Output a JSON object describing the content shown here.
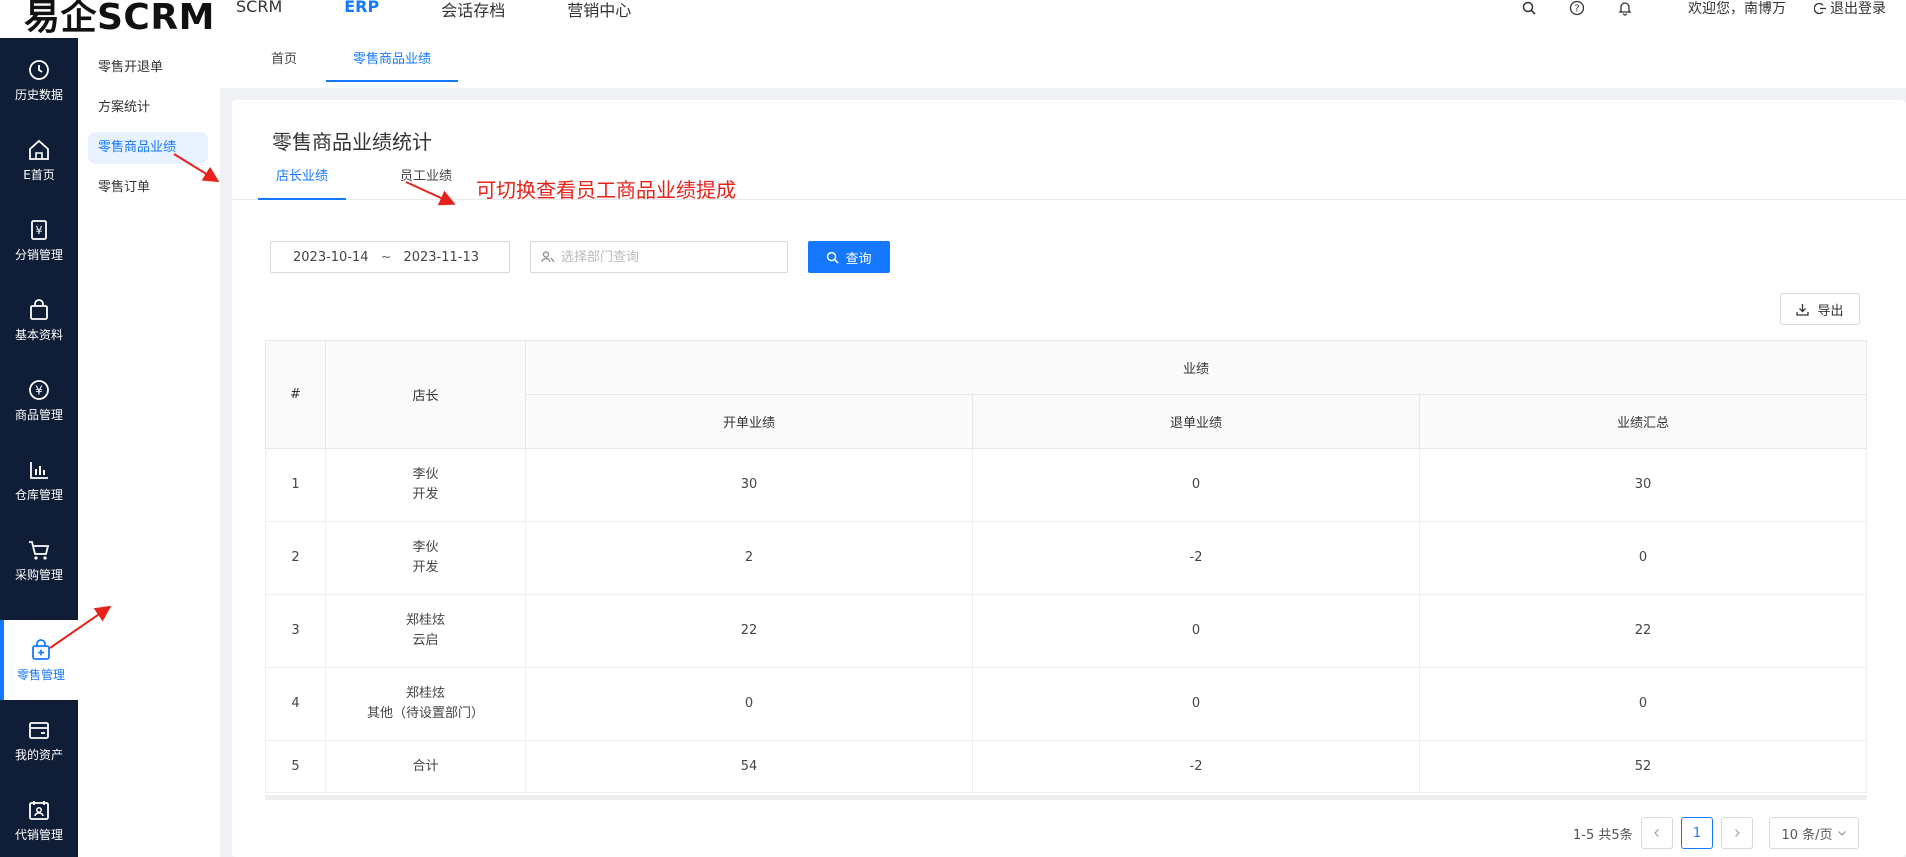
{
  "header": {
    "logo": "易企SCRM",
    "nav": [
      {
        "label": "SCRM",
        "active": false
      },
      {
        "label": "ERP",
        "active": true
      },
      {
        "label": "会话存档",
        "active": false
      },
      {
        "label": "营销中心",
        "active": false
      }
    ],
    "welcome": "欢迎您，南博万",
    "logout": "退出登录",
    "icons": [
      "search-icon",
      "help-icon",
      "bell-icon"
    ]
  },
  "sidebar": {
    "items": [
      {
        "label": "历史数据",
        "icon": "clock-icon"
      },
      {
        "label": "E首页",
        "icon": "home-icon"
      },
      {
        "label": "分销管理",
        "icon": "yen-doc-icon"
      },
      {
        "label": "基本资料",
        "icon": "bag-icon"
      },
      {
        "label": "商品管理",
        "icon": "yen-circle-icon"
      },
      {
        "label": "仓库管理",
        "icon": "bar-chart-icon"
      },
      {
        "label": "采购管理",
        "icon": "cart-icon"
      },
      {
        "label": "零售管理",
        "icon": "retail-icon",
        "active": true
      },
      {
        "label": "我的资产",
        "icon": "wallet-icon"
      },
      {
        "label": "代销管理",
        "icon": "calendar-user-icon"
      }
    ]
  },
  "submenu": {
    "items": [
      {
        "label": "零售开退单"
      },
      {
        "label": "方案统计"
      },
      {
        "label": "零售商品业绩",
        "active": true
      },
      {
        "label": "零售订单"
      }
    ]
  },
  "tabs": [
    {
      "label": "首页"
    },
    {
      "label": "零售商品业绩",
      "active": true
    }
  ],
  "main": {
    "title": "零售商品业绩统计",
    "subtabs": [
      {
        "label": "店长业绩",
        "active": true
      },
      {
        "label": "员工业绩"
      }
    ],
    "annotation": "可切换查看员工商品业绩提成",
    "filters": {
      "date_start": "2023-10-14",
      "date_sep": "~",
      "date_end": "2023-11-13",
      "dept_placeholder": "选择部门查询",
      "query_label": "查询"
    },
    "export_label": "导出",
    "table": {
      "headers": {
        "index": "#",
        "manager": "店长",
        "group": "业绩",
        "open": "开单业绩",
        "refund": "退单业绩",
        "total": "业绩汇总"
      },
      "rows": [
        {
          "index": "1",
          "name1": "李伙",
          "name2": "开发",
          "open": "30",
          "refund": "0",
          "total": "30"
        },
        {
          "index": "2",
          "name1": "李伙",
          "name2": "开发",
          "open": "2",
          "refund": "-2",
          "total": "0"
        },
        {
          "index": "3",
          "name1": "郑桂炫",
          "name2": "云启",
          "open": "22",
          "refund": "0",
          "total": "22"
        },
        {
          "index": "4",
          "name1": "郑桂炫",
          "name2": "其他（待设置部门）",
          "open": "0",
          "refund": "0",
          "total": "0"
        },
        {
          "index": "5",
          "name1": "合计",
          "name2": "",
          "open": "54",
          "refund": "-2",
          "total": "52"
        }
      ]
    },
    "pagination": {
      "total_text": "1-5 共5条",
      "current_page": "1",
      "page_size": "10 条/页"
    }
  },
  "colors": {
    "primary": "#1677ff",
    "sidebar_bg": "#0f1e36",
    "annotation": "#e8221a"
  }
}
